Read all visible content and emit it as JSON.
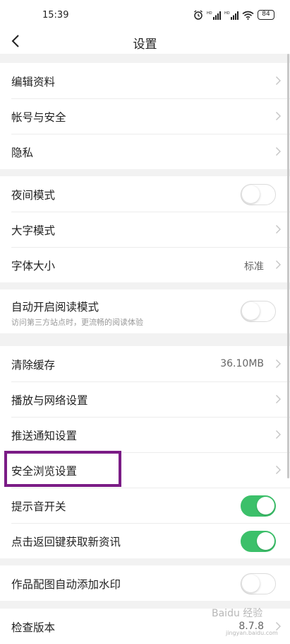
{
  "status_bar": {
    "time": "15:39",
    "battery": "84",
    "icons": [
      "alarm-icon",
      "signal-icon",
      "signal-icon",
      "wifi-icon",
      "battery-icon"
    ]
  },
  "header": {
    "title": "设置",
    "back_icon": "chevron-left-icon"
  },
  "groups": [
    {
      "items": [
        {
          "label": "编辑资料",
          "control": "chevron"
        },
        {
          "label": "帐号与安全",
          "control": "chevron"
        },
        {
          "label": "隐私",
          "control": "chevron"
        }
      ]
    },
    {
      "items": [
        {
          "label": "夜间模式",
          "control": "toggle",
          "on": false
        },
        {
          "label": "大字模式",
          "control": "chevron"
        },
        {
          "label": "字体大小",
          "value": "标准",
          "control": "chevron"
        }
      ]
    },
    {
      "items": [
        {
          "label": "自动开启阅读模式",
          "sublabel": "访问第三方站点时，更流畅的阅读体验",
          "control": "toggle",
          "on": false
        }
      ]
    },
    {
      "items": [
        {
          "label": "清除缓存",
          "value": "36.10MB",
          "control": "chevron"
        },
        {
          "label": "播放与网络设置",
          "control": "chevron"
        },
        {
          "label": "推送通知设置",
          "control": "chevron"
        },
        {
          "label": "安全浏览设置",
          "control": "chevron",
          "highlighted": true
        },
        {
          "label": "提示音开关",
          "control": "toggle",
          "on": true
        },
        {
          "label": "点击返回键获取新资讯",
          "control": "toggle",
          "on": true
        }
      ]
    },
    {
      "items": [
        {
          "label": "作品配图自动添加水印",
          "control": "toggle",
          "on": false
        }
      ]
    },
    {
      "items": [
        {
          "label": "检查版本",
          "value": "8.7.8",
          "control": "chevron"
        }
      ]
    }
  ],
  "colors": {
    "toggle_on": "#3cc06a",
    "highlight_border": "#7b1c86",
    "background": "#f2f2f2"
  },
  "watermark": {
    "text": "Baidu 经验",
    "sub": "jingyan.baidu.com"
  }
}
